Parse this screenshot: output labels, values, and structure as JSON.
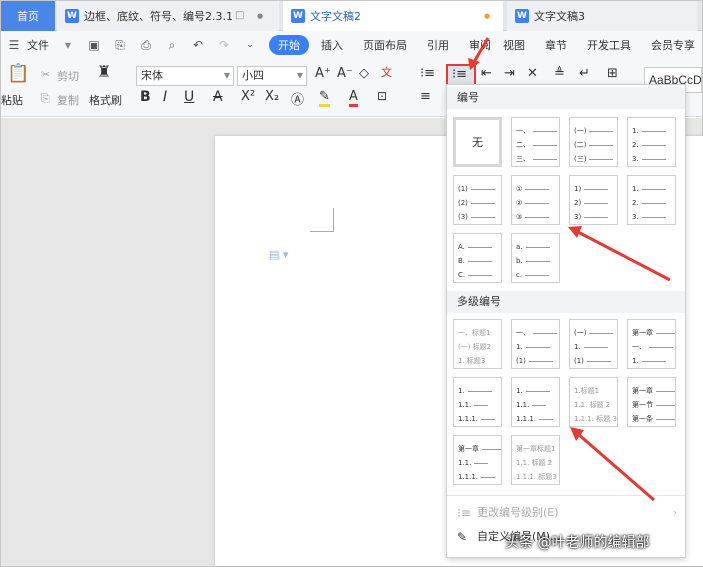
{
  "tabs": {
    "home": "首页",
    "doc1": "边框、底纹、符号、编号2.3.1",
    "doc1_icon": "□",
    "doc1_dot": "●",
    "doc2": "文字文稿2",
    "doc2_dot": "●",
    "doc3": "文字文稿3",
    "word_icon": "W"
  },
  "menu": {
    "file": "文件",
    "undo": "↶",
    "redo": "↷",
    "items": [
      "开始",
      "插入",
      "页面布局",
      "引用",
      "审阅",
      "视图",
      "章节",
      "开发工具",
      "会员专享"
    ]
  },
  "ribbon": {
    "paste": "粘贴",
    "cut": "剪切",
    "copy": "复制",
    "format_painter": "格式刷",
    "font": "宋体",
    "size": "小四",
    "grow": "A⁺",
    "shrink": "A⁻",
    "bold": "B",
    "italic": "I",
    "underline": "U",
    "strike": "A",
    "superscript": "X²",
    "subscript": "X₂",
    "style_preview": "AaBbCcD"
  },
  "numbering_panel": {
    "section1": "编号",
    "none_label": "无",
    "section2": "多级编号",
    "change_level": "更改编号级别(E)",
    "custom": "自定义编号(M)..."
  },
  "numbering_cells": [
    {
      "lines": [
        "一、",
        "二、",
        "三、"
      ]
    },
    {
      "lines": [
        "(一)",
        "(二)",
        "(三)"
      ]
    },
    {
      "lines": [
        "1.",
        "2.",
        "3."
      ]
    },
    {
      "lines": [
        "(1)",
        "(2)",
        "(3)"
      ]
    },
    {
      "lines": [
        "①",
        "②",
        "③"
      ]
    },
    {
      "lines": [
        "1)",
        "2)",
        "3)"
      ]
    },
    {
      "lines": [
        "1.",
        "2.",
        "3."
      ]
    },
    {
      "lines": [
        "A.",
        "B.",
        "C."
      ]
    },
    {
      "lines": [
        "a.",
        "b.",
        "c."
      ]
    }
  ],
  "multilevel_cells": [
    {
      "lines": [
        "一、标题1",
        "(一) 标题2",
        "1. 标题3"
      ]
    },
    {
      "lines": [
        "一、",
        "1.",
        "(1)"
      ]
    },
    {
      "lines": [
        "(一)",
        "1.",
        "(1)"
      ]
    },
    {
      "lines": [
        "第一章",
        "一、",
        "1."
      ]
    },
    {
      "lines": [
        "1.",
        "1.1.",
        "1.1.1."
      ]
    },
    {
      "lines": [
        "1.",
        "1.1.",
        "1.1.1."
      ]
    },
    {
      "lines": [
        "1.标题1",
        "1.1. 标题 2",
        "1.1.1. 标题 3"
      ]
    },
    {
      "lines": [
        "第一章",
        "第一节",
        "第一条"
      ]
    },
    {
      "lines": [
        "第一章",
        "1.1.",
        "1.1.1."
      ]
    },
    {
      "lines": [
        "第一章标题1",
        "1.1. 标题 2",
        "1.1.1. 标题3"
      ]
    }
  ],
  "watermark": "头条 @叶老师的编辑部",
  "colors": {
    "accent": "#3c7ff4",
    "arrow": "#e53935",
    "home_tab": "#4a86e8"
  }
}
